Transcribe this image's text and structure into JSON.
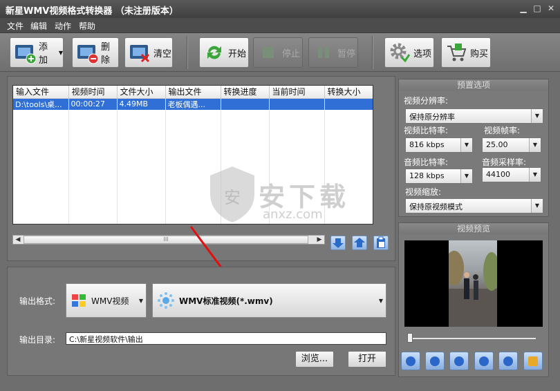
{
  "window": {
    "title": "新星WMV视频格式转换器 （未注册版本）"
  },
  "menu": [
    "文件",
    "编辑",
    "动作",
    "帮助"
  ],
  "toolbar": {
    "add": "添加",
    "delete": "删除",
    "clear": "清空",
    "start": "开始",
    "stop": "停止",
    "pause": "暂停",
    "options": "选项",
    "buy": "购买"
  },
  "table": {
    "columns": [
      "输入文件",
      "视频时间",
      "文件大小",
      "输出文件",
      "转换进度",
      "当前时间",
      "转换大小"
    ],
    "rows": [
      [
        "D:\\tools\\桌...",
        "00:00:27",
        "4.49MB",
        "老板偶遇...",
        "",
        "",
        ""
      ]
    ]
  },
  "scroll_thumb": "III",
  "output": {
    "format_label": "输出格式:",
    "format_category": "WMV视频",
    "format_profile": "WMV标准视频(*.wmv)",
    "dir_label": "输出目录:",
    "dir_value": "C:\\新星视频软件\\输出",
    "browse": "浏览...",
    "open": "打开"
  },
  "preset": {
    "title": "预置选项",
    "resolution_label": "视频分辨率:",
    "resolution_value": "保持原分辨率",
    "vbitrate_label": "视频比特率:",
    "vbitrate_value": "816 kbps",
    "framerate_label": "视频帧率:",
    "framerate_value": "25.00",
    "abitrate_label": "音频比特率:",
    "abitrate_value": "128 kbps",
    "samplerate_label": "音频采样率:",
    "samplerate_value": "44100",
    "scale_label": "视频缩放:",
    "scale_value": "保持原视频模式"
  },
  "preview": {
    "title": "视频预览"
  },
  "watermark": {
    "text": "安下载",
    "sub": "anxz.com"
  },
  "colors": {
    "accent": "#2f6fd6",
    "panel": "#777777",
    "arrow": "#e01010"
  }
}
